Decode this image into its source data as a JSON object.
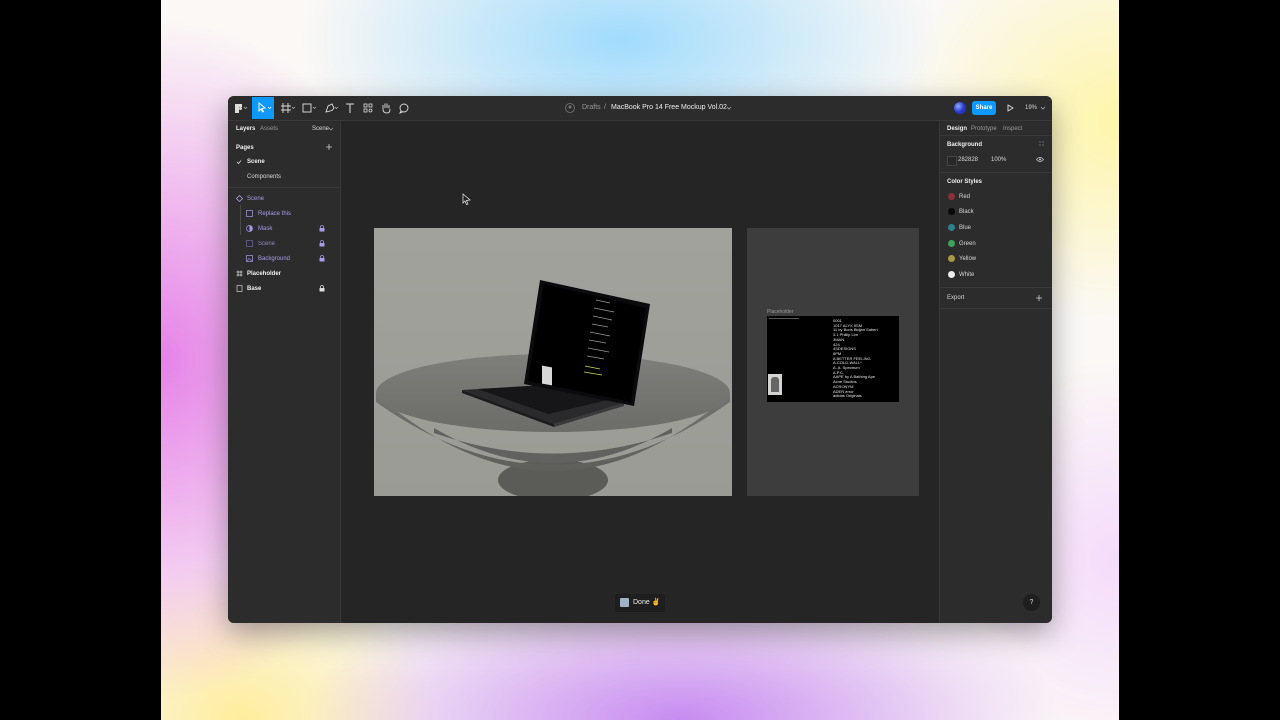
{
  "toolbar": {
    "breadcrumb_team": "Drafts",
    "separator": "/",
    "file_name": "MacBook Pro 14 Free Mockup Vol.02",
    "share_label": "Share",
    "zoom": "19%"
  },
  "left_panel": {
    "tabs": [
      "Layers",
      "Assets"
    ],
    "page_selector": "Scene",
    "pages_heading": "Pages",
    "pages": [
      "Scene",
      "Components"
    ],
    "layers": [
      {
        "label": "Scene",
        "color": "purple"
      },
      {
        "label": "Replace this",
        "color": "purple"
      },
      {
        "label": "Mask",
        "color": "purple"
      },
      {
        "label": "Scene",
        "color": "purple"
      },
      {
        "label": "Background",
        "color": "purple"
      },
      {
        "label": "Placeholder",
        "color": "white"
      },
      {
        "label": "Base",
        "color": "white"
      }
    ]
  },
  "right_panel": {
    "tabs": [
      "Design",
      "Prototype",
      "Inspect"
    ],
    "background_heading": "Background",
    "background_hex": "282828",
    "background_opacity": "100%",
    "color_styles_heading": "Color Styles",
    "color_styles": [
      {
        "name": "Red",
        "color": "#8c2f3a"
      },
      {
        "name": "Black",
        "color": "#0a0a0a"
      },
      {
        "name": "Blue",
        "color": "#2f7f8f"
      },
      {
        "name": "Green",
        "color": "#3fa35a"
      },
      {
        "name": "Yellow",
        "color": "#a59b45"
      },
      {
        "name": "White",
        "color": "#eeeeee"
      }
    ],
    "export_heading": "Export"
  },
  "canvas": {
    "placeholder_label": "Placeholder",
    "screen_lines": [
      "0001",
      "1017 ALYX 9SM",
      "11 by Boris Bidjan Saberi",
      "3.1 Phillip Lim",
      "3MAN",
      "424",
      "4SDESIGNS",
      "6PM",
      "A BETTER FEELING",
      "A-COLD-WALL*",
      "A. A. Spectrum",
      "A.P.C.",
      "AAPE by A Bathing Ape",
      "Acne Studios",
      "ACRONYM",
      "ADER error",
      "adidas Originals"
    ],
    "toast": "Done ✌"
  },
  "help_label": "?"
}
